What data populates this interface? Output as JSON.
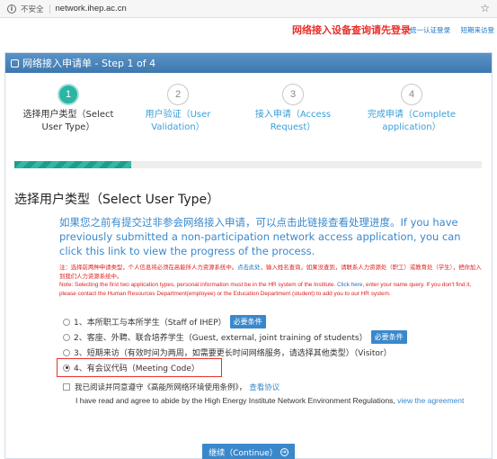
{
  "browser": {
    "security_label": "不安全",
    "url": "network.ihep.ac.cn"
  },
  "header": {
    "login_prompt": "网络接入设备查询请先登录",
    "unified_login": "统一认证登录",
    "short_term_login": "短期来访登"
  },
  "panel": {
    "title": "网络接入申请单 - Step 1 of 4"
  },
  "steps": [
    {
      "number": "1",
      "label": "选择用户类型（Select User Type）"
    },
    {
      "number": "2",
      "label": "用户验证（User Validation）"
    },
    {
      "number": "3",
      "label": "接入申请（Access Request）"
    },
    {
      "number": "4",
      "label": "完成申请（Complete application）"
    }
  ],
  "progress": {
    "fraction": 0.25
  },
  "section_title": "选择用户类型（Select User Type）",
  "check_link": "如果您之前有提交过非参会网络接入申请，可以点击此链接查看处理进度。If you have previously submitted a non-participation network access application, you can click this link to view the progress of the process.",
  "notice": {
    "cn_before": "注：选择前两种申请类型，个人信息将必须在高能所人力资源系统中。",
    "cn_link": "点击此处",
    "cn_after": "，输入姓名查询，如果没查到，请联系人力资源处（职工）或教育处（学生），把你加入到我们人力资源系统中。",
    "en_before": "Note: Selecting the first two application types, personal information must be in the HR system of the Institute.",
    "en_link": "Click here,",
    "en_after": "enter your name query. If you don't find it, please contact the Human Resources Department(employee) or the Education Department (student) to add you to our HR system."
  },
  "options": [
    {
      "label": "1、本所职工与本所学生（Staff of IHEP）",
      "required": "必要条件",
      "checked": false
    },
    {
      "label": "2、客座、外聘、联合培养学生（Guest, external, joint training of students）",
      "required": "必要条件",
      "checked": false
    },
    {
      "label": "3、短期来访（有效时间为两周，如需要更长时间网络服务，请选择其他类型）（Visitor）",
      "required": "",
      "checked": false
    },
    {
      "label": "4、有会议代码（Meeting Code）",
      "required": "",
      "checked": true
    }
  ],
  "agreement": {
    "cn_text": "我已阅读并同意遵守《高能所网络环境使用条例》，",
    "cn_link": "查看协议",
    "en_text": "I have read and agree to abide by the High Energy Institute Network Environment Regulations,",
    "en_link": "view the agreement"
  },
  "continue_label": "继续（Continue）"
}
